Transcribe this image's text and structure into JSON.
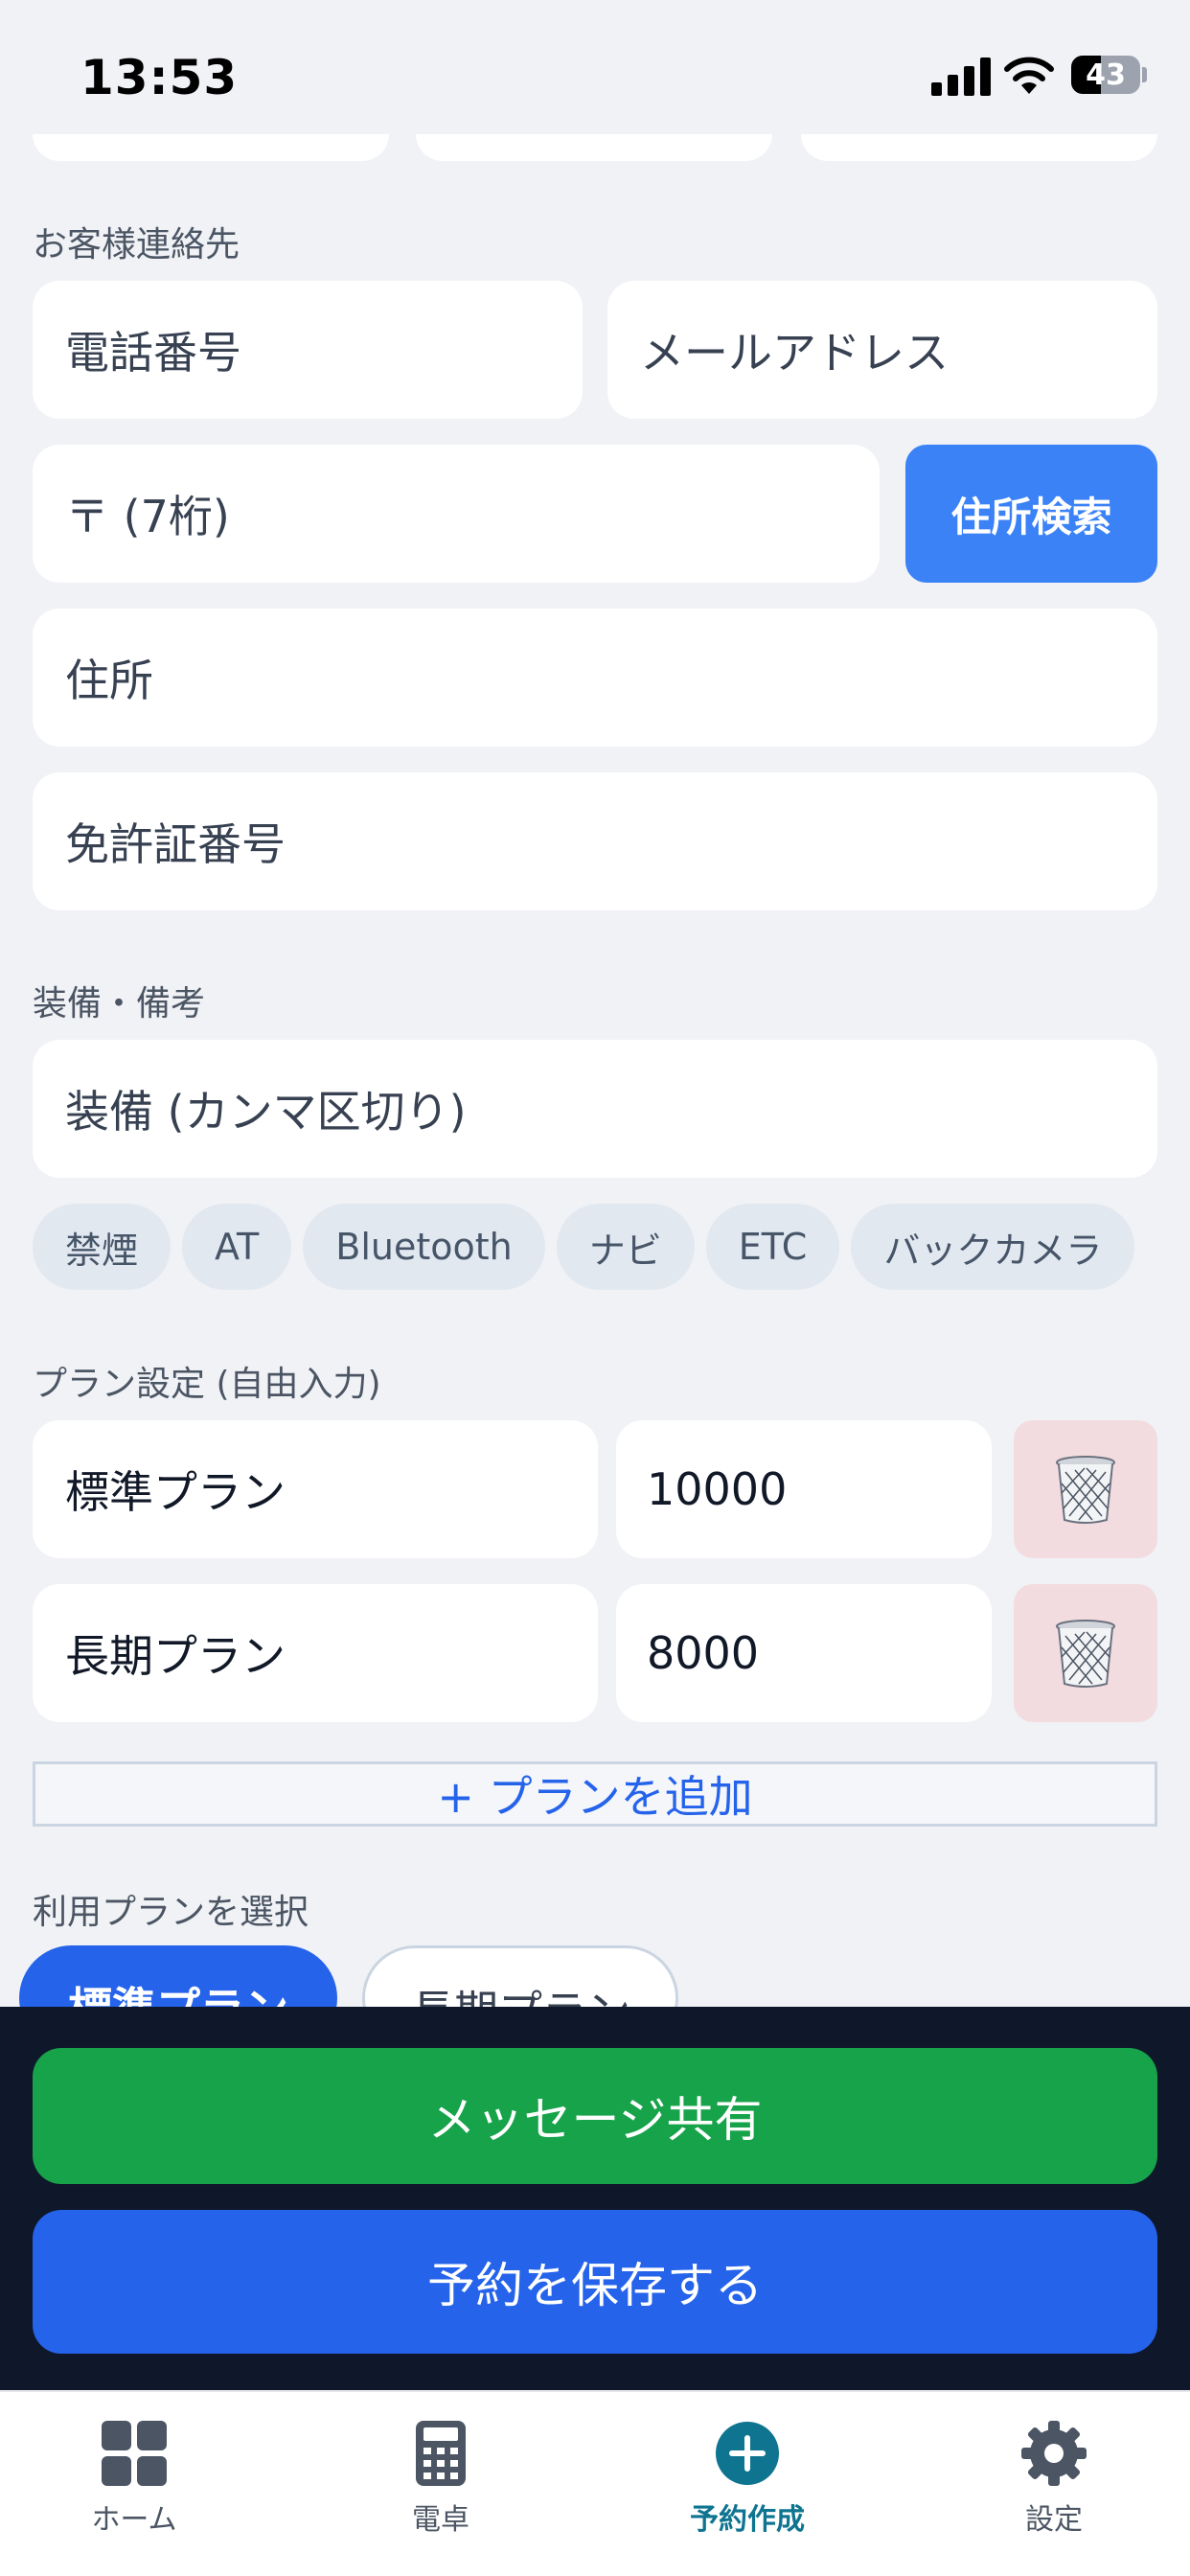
{
  "status_bar": {
    "time": "13:53",
    "battery": "43"
  },
  "contact": {
    "section_label": "お客様連絡先",
    "phone_placeholder": "電話番号",
    "email_placeholder": "メールアドレス",
    "postal_placeholder": "〒 (7桁)",
    "address_search_label": "住所検索",
    "address_placeholder": "住所",
    "license_placeholder": "免許証番号"
  },
  "equipment": {
    "section_label": "装備・備考",
    "equipment_placeholder": "装備 (カンマ区切り)",
    "chips": [
      "禁煙",
      "AT",
      "Bluetooth",
      "ナビ",
      "ETC",
      "バックカメラ"
    ]
  },
  "plans": {
    "section_label": "プラン設定 (自由入力)",
    "rows": [
      {
        "name": "標準プラン",
        "price": "10000"
      },
      {
        "name": "長期プラン",
        "price": "8000"
      }
    ],
    "add_label": "+ プランを追加"
  },
  "plan_select": {
    "section_label": "利用プランを選択",
    "options": [
      "標準プラン",
      "長期プラン"
    ],
    "selected": "標準プラン"
  },
  "actions": {
    "share_label": "メッセージ共有",
    "save_label": "予約を保存する"
  },
  "tabs": [
    {
      "label": "ホーム",
      "icon": "grid-icon"
    },
    {
      "label": "電卓",
      "icon": "calculator-icon"
    },
    {
      "label": "予約作成",
      "icon": "plus-circle-icon",
      "active": true
    },
    {
      "label": "設定",
      "icon": "gear-icon"
    }
  ],
  "colors": {
    "primary": "#3b82f6",
    "share": "#16a34a",
    "save": "#2563eb",
    "active_tab": "#0e7490"
  }
}
